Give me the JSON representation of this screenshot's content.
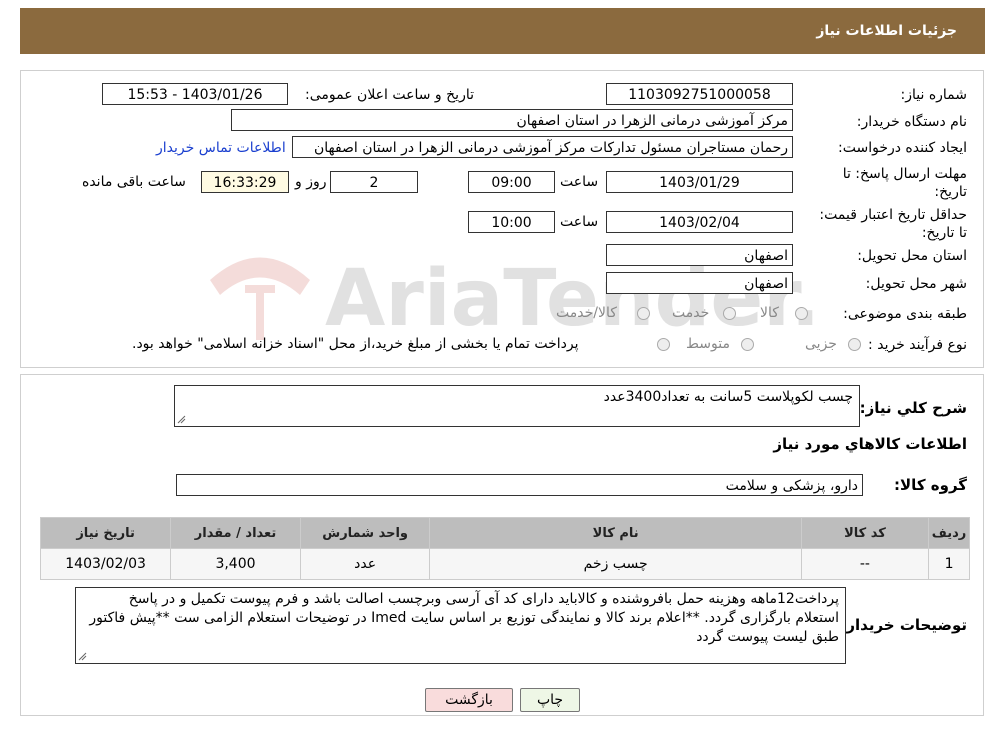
{
  "page_title": "جزئیات اطلاعات نیاز",
  "labels": {
    "need_number": "شماره نیاز:",
    "announce_datetime": "تاریخ و ساعت اعلان عمومی:",
    "buyer_org": "نام دستگاه خریدار:",
    "requester": "ایجاد کننده درخواست:",
    "reply_deadline": "مهلت ارسال پاسخ: تا تاریخ:",
    "hour": "ساعت",
    "day_and": "روز و",
    "remaining": "ساعت باقی مانده",
    "price_validity": "حداقل تاریخ اعتبار قیمت: تا تاریخ:",
    "province": "استان محل تحویل:",
    "city": "شهر محل تحویل:",
    "category": "طبقه بندی موضوعی:",
    "process_type": "نوع فرآیند خرید :",
    "general_desc": "شرح کلي نياز:",
    "goods_info": "اطلاعات کالاهاي مورد نياز",
    "goods_group": "گروه کالا:",
    "buyer_notes": "توضیحات خریدار:"
  },
  "values": {
    "need_number": "1103092751000058",
    "announce_datetime": "1403/01/26 - 15:53",
    "buyer_org": "مرکز آموزشی درمانی الزهرا در استان اصفهان",
    "requester": "رحمان مستاجران مسئول تدارکات مرکز آموزشی درمانی الزهرا در استان اصفهان",
    "contact_link": "اطلاعات تماس خریدار",
    "reply_date": "1403/01/29",
    "reply_time": "09:00",
    "days": "2",
    "remaining_time": "16:33:29",
    "validity_date": "1403/02/04",
    "validity_time": "10:00",
    "province": "اصفهان",
    "city": "اصفهان",
    "general_desc": "چسب لکوپلاست 5سانت به تعداد3400عدد",
    "goods_group": "دارو، پزشکی و سلامت",
    "buyer_notes": "پرداخت12ماهه وهزینه حمل بافروشنده و کالاباید دارای کد آی آرسی وبرچسب اصالت باشد و فرم پیوست تکمیل و در پاسخ استعلام بارگزاری گردد. **اعلام برند کالا و نمایندگی توزیع بر اساس سایت Imed در توضیحات استعلام الزامی ست **پیش فاکتور طبق لیست پیوست گردد"
  },
  "category_options": [
    "کالا",
    "خدمت",
    "کالا/خدمت"
  ],
  "process_options": [
    "جزیی",
    "متوسط"
  ],
  "process_note": "پرداخت تمام یا بخشی از مبلغ خرید،از محل \"اسناد خزانه اسلامی\" خواهد بود.",
  "table": {
    "headers": [
      "ردیف",
      "کد کالا",
      "نام کالا",
      "واحد شمارش",
      "تعداد / مقدار",
      "تاریخ نیاز"
    ],
    "rows": [
      [
        "1",
        "--",
        "چسب زخم",
        "عدد",
        "3,400",
        "1403/02/03"
      ]
    ]
  },
  "buttons": {
    "print": "چاپ",
    "back": "بازگشت"
  },
  "watermark": "AriaTender.neT",
  "colors": {
    "header": "#8B6A3E",
    "link": "#1a3fcf",
    "back_button": "#f9dcdc",
    "print_button": "#eef7e6"
  }
}
